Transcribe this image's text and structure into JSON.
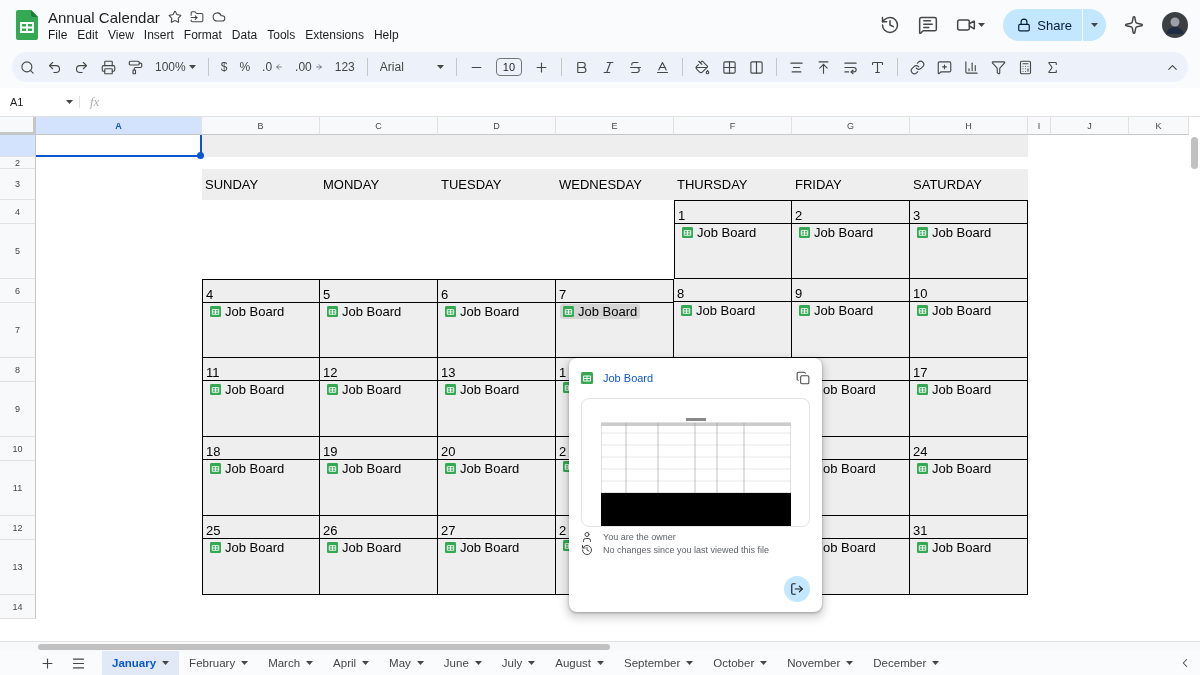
{
  "doc": {
    "title": "Annual Calendar"
  },
  "menu": [
    "File",
    "Edit",
    "View",
    "Insert",
    "Format",
    "Data",
    "Tools",
    "Extensions",
    "Help"
  ],
  "share": {
    "label": "Share"
  },
  "toolbar": {
    "zoom": "100%",
    "currency": "$",
    "percent": "%",
    "decrease_decimal": ".0",
    "increase_decimal": ".00",
    "number_format": "123",
    "font": "Arial",
    "font_size": "10"
  },
  "formula_bar": {
    "cell": "A1",
    "fx": "fx"
  },
  "columns": [
    {
      "label": "A",
      "selected": true
    },
    {
      "label": "B",
      "selected": false
    },
    {
      "label": "C",
      "selected": false
    },
    {
      "label": "D",
      "selected": false
    },
    {
      "label": "E",
      "selected": false
    },
    {
      "label": "F",
      "selected": false
    },
    {
      "label": "G",
      "selected": false
    },
    {
      "label": "H",
      "selected": false
    },
    {
      "label": "I",
      "selected": false
    },
    {
      "label": "J",
      "selected": false
    },
    {
      "label": "K",
      "selected": false
    }
  ],
  "rows": [
    {
      "selected": true
    },
    {
      "label": "2",
      "selected": false
    },
    {
      "label": "3",
      "selected": false
    },
    {
      "label": "4",
      "selected": false
    },
    {
      "label": "5",
      "selected": false
    },
    {
      "label": "6",
      "selected": false
    },
    {
      "label": "7",
      "selected": false
    },
    {
      "label": "8",
      "selected": false
    },
    {
      "label": "9",
      "selected": false
    },
    {
      "label": "10",
      "selected": false
    },
    {
      "label": "11",
      "selected": false
    },
    {
      "label": "12",
      "selected": false
    },
    {
      "label": "13",
      "selected": false
    },
    {
      "label": "14",
      "selected": false
    }
  ],
  "weekdays": [
    "SUNDAY",
    "MONDAY",
    "TUESDAY",
    "WEDNESDAY",
    "THURSDAY",
    "FRIDAY",
    "SATURDAY"
  ],
  "weeks": [
    [
      {
        "kind": "empty"
      },
      {
        "kind": "empty"
      },
      {
        "kind": "empty"
      },
      {
        "kind": "empty"
      },
      {
        "kind": "day",
        "day": "1",
        "label": "Job Board",
        "hovered": false
      },
      {
        "kind": "day",
        "day": "2",
        "label": "Job Board",
        "hovered": false
      },
      {
        "kind": "day",
        "day": "3",
        "label": "Job Board",
        "hovered": false
      }
    ],
    [
      {
        "kind": "day",
        "day": "4",
        "label": "Job Board",
        "hovered": false
      },
      {
        "kind": "day",
        "day": "5",
        "label": "Job Board",
        "hovered": false
      },
      {
        "kind": "day",
        "day": "6",
        "label": "Job Board",
        "hovered": false
      },
      {
        "kind": "day",
        "day": "7",
        "label": "Job Board",
        "hovered": true
      },
      {
        "kind": "day",
        "day": "8",
        "label": "Job Board",
        "hovered": false
      },
      {
        "kind": "day",
        "day": "9",
        "label": "Job Board",
        "hovered": false
      },
      {
        "kind": "day",
        "day": "10",
        "label": "Job Board",
        "hovered": false
      }
    ],
    [
      {
        "kind": "day",
        "day": "11",
        "label": "Job Board",
        "hovered": false
      },
      {
        "kind": "day",
        "day": "12",
        "label": "Job Board",
        "hovered": false
      },
      {
        "kind": "day",
        "day": "13",
        "label": "Job Board",
        "hovered": false
      },
      {
        "kind": "cut_right",
        "day": "1"
      },
      {
        "kind": "empty"
      },
      {
        "kind": "cut_left",
        "label": "ob Board"
      },
      {
        "kind": "day",
        "day": "17",
        "label": "Job Board",
        "hovered": false
      }
    ],
    [
      {
        "kind": "day",
        "day": "18",
        "label": "Job Board",
        "hovered": false
      },
      {
        "kind": "day",
        "day": "19",
        "label": "Job Board",
        "hovered": false
      },
      {
        "kind": "day",
        "day": "20",
        "label": "Job Board",
        "hovered": false
      },
      {
        "kind": "cut_right",
        "day": "2"
      },
      {
        "kind": "empty"
      },
      {
        "kind": "cut_left",
        "label": "ob Board"
      },
      {
        "kind": "day",
        "day": "24",
        "label": "Job Board",
        "hovered": false
      }
    ],
    [
      {
        "kind": "day",
        "day": "25",
        "label": "Job Board",
        "hovered": false
      },
      {
        "kind": "day",
        "day": "26",
        "label": "Job Board",
        "hovered": false
      },
      {
        "kind": "day",
        "day": "27",
        "label": "Job Board",
        "hovered": false
      },
      {
        "kind": "cut_right",
        "day": "2"
      },
      {
        "kind": "empty"
      },
      {
        "kind": "cut_left",
        "label": "ob Board"
      },
      {
        "kind": "day",
        "day": "31",
        "label": "Job Board",
        "hovered": false
      }
    ]
  ],
  "popup": {
    "title": "Job Board",
    "owner_note": "You are the owner",
    "history_note": "No changes since you last viewed this file"
  },
  "sheets": [
    {
      "label": "January",
      "selected": true
    },
    {
      "label": "February",
      "selected": false
    },
    {
      "label": "March",
      "selected": false
    },
    {
      "label": "April",
      "selected": false
    },
    {
      "label": "May",
      "selected": false
    },
    {
      "label": "June",
      "selected": false
    },
    {
      "label": "July",
      "selected": false
    },
    {
      "label": "August",
      "selected": false
    },
    {
      "label": "September",
      "selected": false
    },
    {
      "label": "October",
      "selected": false
    },
    {
      "label": "November",
      "selected": false
    },
    {
      "label": "December",
      "selected": false
    }
  ]
}
